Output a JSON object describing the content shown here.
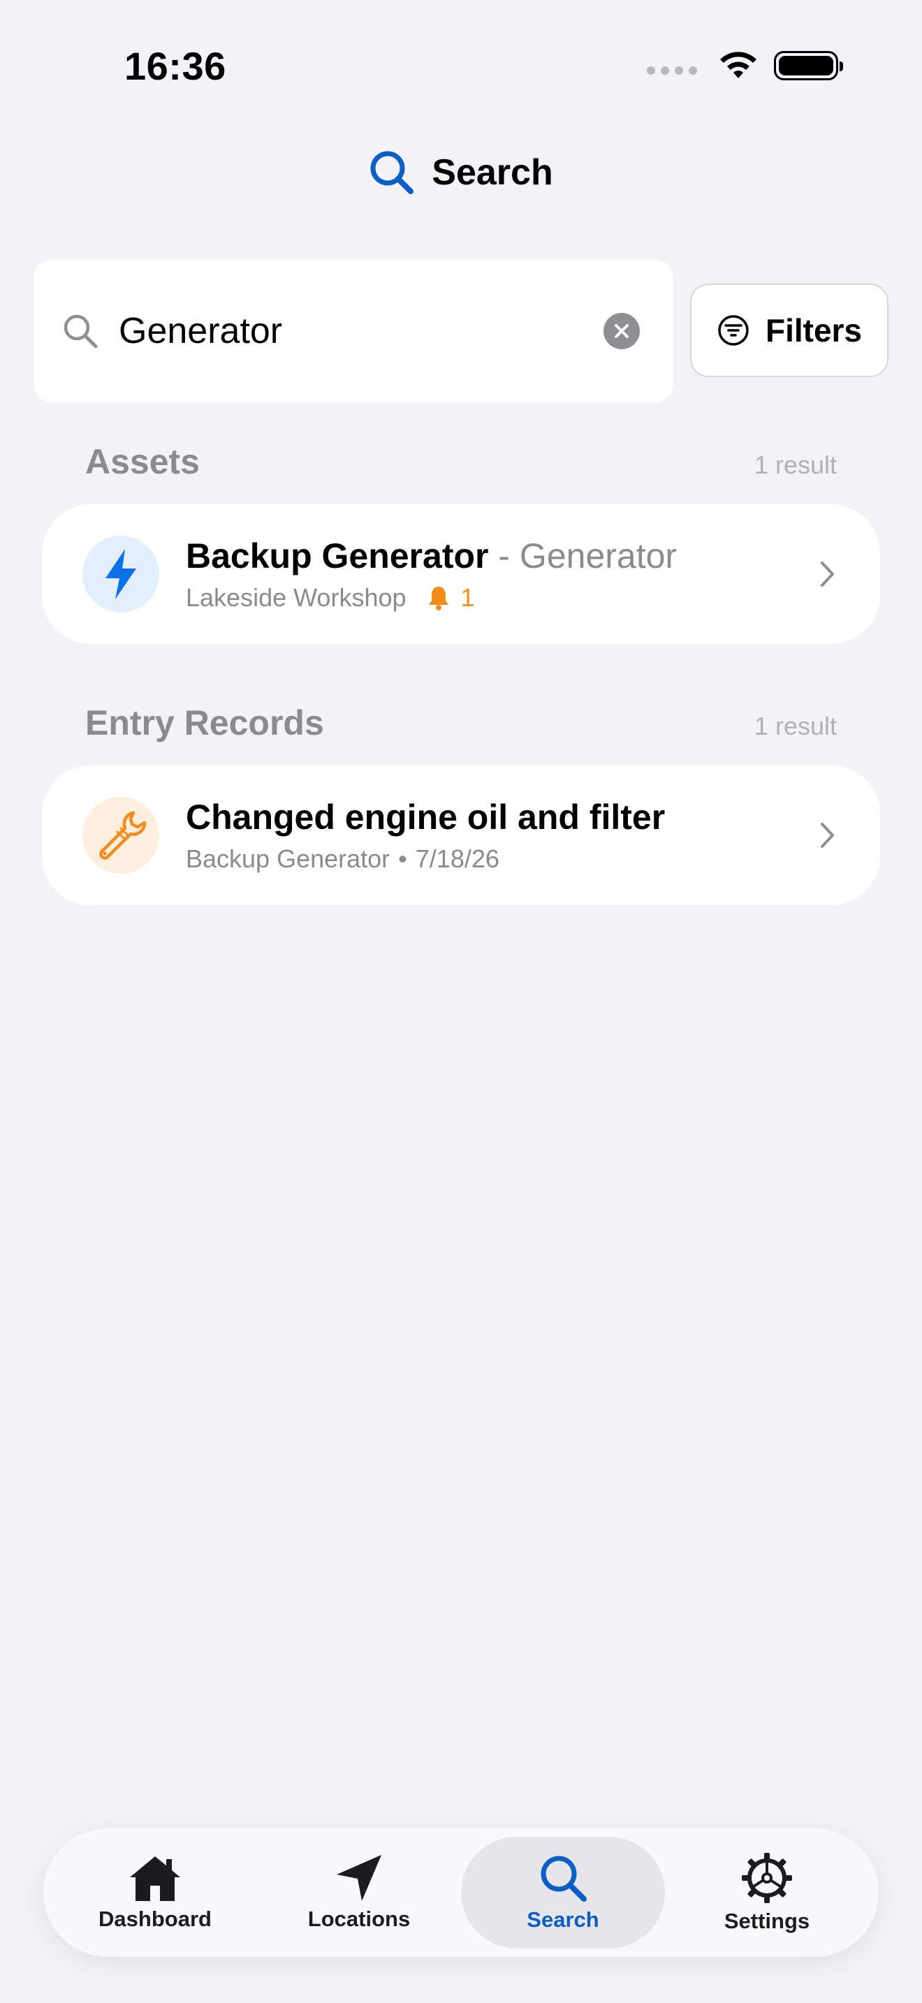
{
  "status_bar": {
    "time": "16:36"
  },
  "header": {
    "title": "Search",
    "icon": "magnifying-glass-icon"
  },
  "search": {
    "value": "Generator",
    "filters_label": "Filters"
  },
  "assets_section": {
    "title": "Assets",
    "count": "1 result",
    "items": [
      {
        "name": "Backup Generator",
        "type": "- Generator",
        "location": "Lakeside Workshop",
        "alerts": "1",
        "icon": "bolt-icon"
      }
    ]
  },
  "records_section": {
    "title": "Entry Records",
    "count": "1 result",
    "items": [
      {
        "title": "Changed engine oil and filter",
        "asset": "Backup Generator",
        "separator": "•",
        "date": "7/18/26",
        "icon": "wrench-icon"
      }
    ]
  },
  "tab_bar": {
    "tabs": [
      {
        "label": "Dashboard",
        "icon": "house-icon"
      },
      {
        "label": "Locations",
        "icon": "location-arrow-icon"
      },
      {
        "label": "Search",
        "icon": "magnifying-glass-icon",
        "active": true
      },
      {
        "label": "Settings",
        "icon": "gear-icon"
      }
    ]
  },
  "colors": {
    "accent": "#0a5ec6",
    "alert": "#f28c1b",
    "background": "#f2f2f7"
  }
}
